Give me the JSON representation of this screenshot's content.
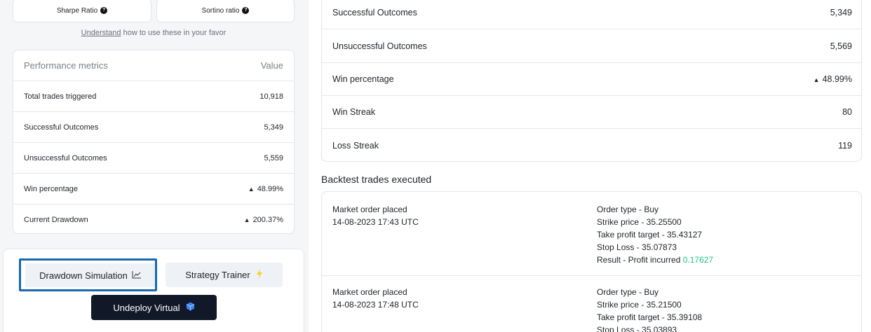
{
  "ratios": {
    "sharpe_label": "Sharpe Ratio",
    "sortino_label": "Sortino ratio",
    "help_icon": "question-circle-icon"
  },
  "understand": {
    "link": "Understand",
    "rest": " how to use these in your favor"
  },
  "metrics": {
    "header_label": "Performance metrics",
    "header_value": "Value",
    "rows": [
      {
        "label": "Total trades triggered",
        "value": "10,918"
      },
      {
        "label": "Successful Outcomes",
        "value": "5,349"
      },
      {
        "label": "Unsuccessful Outcomes",
        "value": "5,559"
      },
      {
        "label": "Win percentage",
        "value": "48.99%",
        "icon": "triangle-up-icon"
      },
      {
        "label": "Current Drawdown",
        "value": "200.37%",
        "icon": "triangle-up-icon"
      }
    ]
  },
  "actions": {
    "drawdown_label": "Drawdown Simulation",
    "drawdown_icon": "line-chart-icon",
    "trainer_label": "Strategy Trainer",
    "trainer_icon": "lightning-icon",
    "undeploy_label": "Undeploy Virtual",
    "undeploy_icon": "cube-icon",
    "highlight_color": "#1768b1"
  },
  "stats": {
    "rows": [
      {
        "label": "Successful Outcomes",
        "value": "5,349"
      },
      {
        "label": "Unsuccessful Outcomes",
        "value": "5,569"
      },
      {
        "label": "Win percentage",
        "value": "48.99%",
        "icon": "triangle-up-icon"
      },
      {
        "label": "Win Streak",
        "value": "80"
      },
      {
        "label": "Loss Streak",
        "value": "119"
      }
    ]
  },
  "backtest": {
    "title": "Backtest trades executed",
    "trades": [
      {
        "placed": "Market order placed",
        "time": "14-08-2023 17:43 UTC",
        "order_type": "Order type - Buy",
        "strike": "Strike price - 35.25500",
        "take_profit": "Take profit target - 35.43127",
        "stop_loss": "Stop Loss - 35.07873",
        "result_prefix": "Result - Profit incurred ",
        "result_value": "0.17627"
      },
      {
        "placed": "Market order placed",
        "time": "14-08-2023 17:48 UTC",
        "order_type": "Order type - Buy",
        "strike": "Strike price - 35.21500",
        "take_profit": "Take profit target - 35.39108",
        "stop_loss": "Stop Loss - 35.03893"
      }
    ],
    "profit_color": "#22c28a"
  }
}
